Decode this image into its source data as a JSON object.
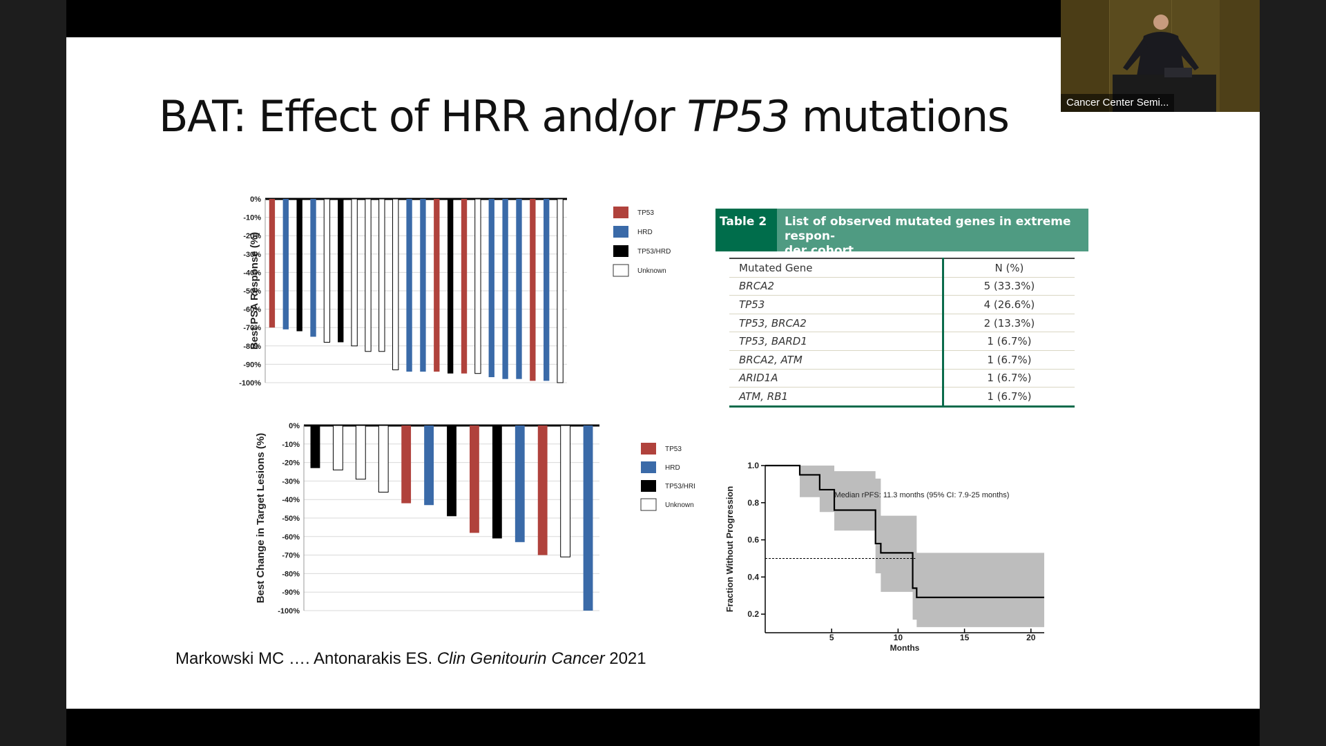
{
  "slide": {
    "title_prefix": "BAT:  Effect of HRR and/or ",
    "title_italic": "TP53",
    "title_suffix": " mutations"
  },
  "citation": {
    "authors": "Markowski MC …. Antonarakis ES. ",
    "journal": "Clin Genitourin Cancer",
    "year": " 2021"
  },
  "video": {
    "label": "Cancer Center Semi..."
  },
  "colors": {
    "TP53": "#b0423c",
    "HRD": "#3a6aa8",
    "TP53/HRD": "#000000",
    "Unknown": "#ffffff",
    "table_header": "#4f9b82",
    "table_accent": "#006d4b",
    "km_band": "#bdbdbd"
  },
  "chart_data": [
    {
      "type": "bar",
      "ylabel": "Best PSA Response (%)",
      "ylim": [
        -100,
        0
      ],
      "yticks": [
        "0%",
        "-10%",
        "-20%",
        "-30%",
        "-40%",
        "-50%",
        "-60%",
        "-70%",
        "-80%",
        "-90%",
        "-100%"
      ],
      "legend": [
        "TP53",
        "HRD",
        "TP53/HRD",
        "Unknown"
      ],
      "legend_position": "right",
      "grid": true,
      "bars": [
        {
          "value": -70,
          "group": "TP53"
        },
        {
          "value": -71,
          "group": "HRD"
        },
        {
          "value": -72,
          "group": "TP53/HRD"
        },
        {
          "value": -75,
          "group": "HRD"
        },
        {
          "value": -78,
          "group": "Unknown"
        },
        {
          "value": -78,
          "group": "TP53/HRD"
        },
        {
          "value": -80,
          "group": "Unknown"
        },
        {
          "value": -83,
          "group": "Unknown"
        },
        {
          "value": -83,
          "group": "Unknown"
        },
        {
          "value": -93,
          "group": "Unknown"
        },
        {
          "value": -94,
          "group": "HRD"
        },
        {
          "value": -94,
          "group": "HRD"
        },
        {
          "value": -94,
          "group": "TP53"
        },
        {
          "value": -95,
          "group": "TP53/HRD"
        },
        {
          "value": -95,
          "group": "TP53"
        },
        {
          "value": -95,
          "group": "Unknown"
        },
        {
          "value": -97,
          "group": "HRD"
        },
        {
          "value": -98,
          "group": "HRD"
        },
        {
          "value": -98,
          "group": "HRD"
        },
        {
          "value": -99,
          "group": "TP53"
        },
        {
          "value": -99,
          "group": "HRD"
        },
        {
          "value": -100,
          "group": "Unknown"
        }
      ]
    },
    {
      "type": "bar",
      "ylabel": "Best Change in Target Lesions (%)",
      "ylim": [
        -100,
        0
      ],
      "yticks": [
        "0%",
        "-10%",
        "-20%",
        "-30%",
        "-40%",
        "-50%",
        "-60%",
        "-70%",
        "-80%",
        "-90%",
        "-100%"
      ],
      "legend": [
        "TP53",
        "HRD",
        "TP53/HRD",
        "Unknown"
      ],
      "legend_position": "right",
      "grid": true,
      "bars": [
        {
          "value": -23,
          "group": "TP53/HRD"
        },
        {
          "value": -24,
          "group": "Unknown"
        },
        {
          "value": -29,
          "group": "Unknown"
        },
        {
          "value": -36,
          "group": "Unknown"
        },
        {
          "value": -42,
          "group": "TP53"
        },
        {
          "value": -43,
          "group": "HRD"
        },
        {
          "value": -49,
          "group": "TP53/HRD"
        },
        {
          "value": -58,
          "group": "TP53"
        },
        {
          "value": -61,
          "group": "TP53/HRD"
        },
        {
          "value": -63,
          "group": "HRD"
        },
        {
          "value": -70,
          "group": "TP53"
        },
        {
          "value": -71,
          "group": "Unknown"
        },
        {
          "value": -100,
          "group": "HRD"
        }
      ]
    },
    {
      "type": "table",
      "tag": "Table 2",
      "title": "List of observed mutated genes in extreme responder cohort.",
      "title_lines": [
        "List of observed mutated genes in extreme respon-",
        "der cohort."
      ],
      "columns": [
        "Mutated Gene",
        "N (%)"
      ],
      "rows": [
        [
          "BRCA2",
          "5 (33.3%)"
        ],
        [
          "TP53",
          "4 (26.6%)"
        ],
        [
          "TP53, BRCA2",
          "2 (13.3%)"
        ],
        [
          "TP53, BARD1",
          "1 (6.7%)"
        ],
        [
          "BRCA2, ATM",
          "1 (6.7%)"
        ],
        [
          "ARID1A",
          "1 (6.7%)"
        ],
        [
          "ATM, RB1",
          "1 (6.7%)"
        ]
      ]
    },
    {
      "type": "line",
      "xlabel": "Months",
      "ylabel": "Fraction Without Progression",
      "annotation": "Median rPFS: 11.3 months (95% CI: 7.9-25 months)",
      "xlim": [
        0,
        21
      ],
      "ylim": [
        0.1,
        1.0
      ],
      "xticks": [
        5,
        10,
        15,
        20
      ],
      "yticks": [
        "1.0",
        "0.8",
        "0.6",
        "0.4",
        "0.2"
      ],
      "median": 11.3,
      "series": [
        {
          "x": [
            0,
            2.6,
            2.6,
            4.1,
            4.1,
            5.2,
            5.2,
            8.3,
            8.3,
            8.7,
            8.7,
            11.1,
            11.1,
            11.4,
            11.4,
            21
          ],
          "y": [
            1.0,
            1.0,
            0.95,
            0.95,
            0.87,
            0.87,
            0.76,
            0.76,
            0.58,
            0.58,
            0.53,
            0.53,
            0.34,
            0.34,
            0.29,
            0.29
          ]
        }
      ],
      "ci_band": {
        "x": [
          2.6,
          4.1,
          5.2,
          8.3,
          8.7,
          11.1,
          11.4,
          21
        ],
        "upper": [
          1.0,
          1.0,
          0.97,
          0.93,
          0.73,
          0.73,
          0.53,
          0.53
        ],
        "lower": [
          0.83,
          0.75,
          0.65,
          0.42,
          0.32,
          0.17,
          0.13,
          0.13
        ]
      }
    }
  ]
}
